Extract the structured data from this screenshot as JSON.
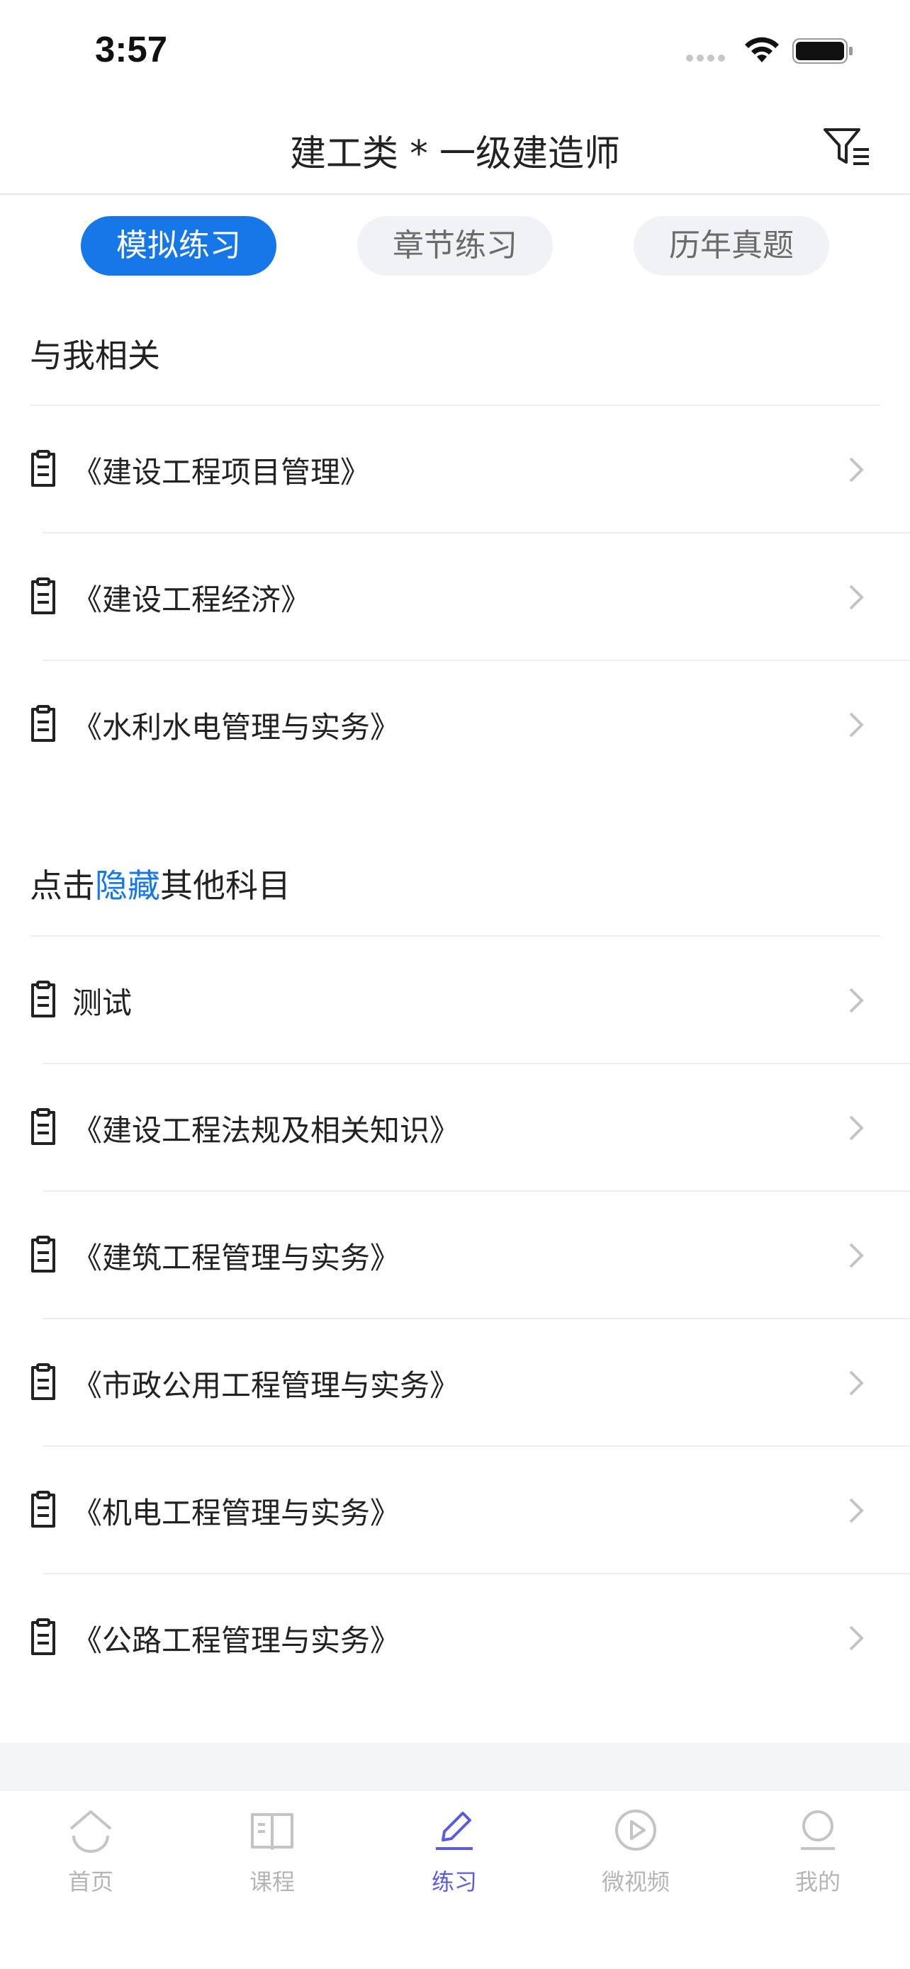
{
  "status_bar": {
    "time": "3:57"
  },
  "header": {
    "title": "建工类 * 一级建造师"
  },
  "tabs": [
    {
      "label": "模拟练习",
      "active": true
    },
    {
      "label": "章节练习",
      "active": false
    },
    {
      "label": "历年真题",
      "active": false
    }
  ],
  "related": {
    "title": "与我相关",
    "items": [
      {
        "label": "《建设工程项目管理》"
      },
      {
        "label": "《建设工程经济》"
      },
      {
        "label": "《水利水电管理与实务》"
      }
    ]
  },
  "others": {
    "title_prefix": "点击",
    "title_link": "隐藏",
    "title_suffix": "其他科目",
    "items": [
      {
        "label": "测试"
      },
      {
        "label": "《建设工程法规及相关知识》"
      },
      {
        "label": "《建筑工程管理与实务》"
      },
      {
        "label": "《市政公用工程管理与实务》"
      },
      {
        "label": "《机电工程管理与实务》"
      },
      {
        "label": "《公路工程管理与实务》"
      }
    ]
  },
  "tab_bar": [
    {
      "label": "首页",
      "icon": "home-icon",
      "active": false
    },
    {
      "label": "课程",
      "icon": "book-icon",
      "active": false
    },
    {
      "label": "练习",
      "icon": "pencil-icon",
      "active": true
    },
    {
      "label": "微视频",
      "icon": "play-icon",
      "active": false
    },
    {
      "label": "我的",
      "icon": "profile-icon",
      "active": false
    }
  ],
  "colors": {
    "accent": "#1677e8",
    "tab_active": "#5b5be0",
    "inactive": "#b5b5b5"
  }
}
